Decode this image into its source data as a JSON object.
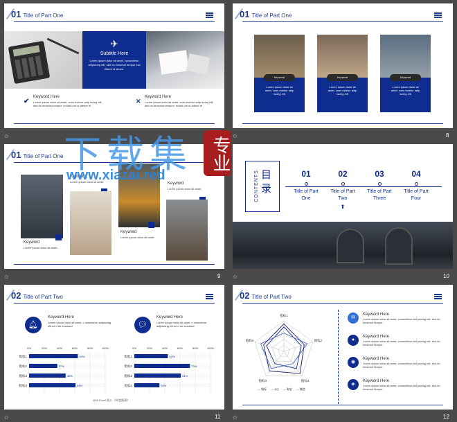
{
  "watermark": {
    "title": "下载集",
    "badge": "专业",
    "url": "www.xiazai.red"
  },
  "slide7": {
    "num": "01",
    "title": "Title of Part One",
    "subtitle": "Subtitle Here",
    "blue_text": "Lorem ipsum dolor sit amet, consectetur adipiscing elit, sed do eiusmod tempor inci didunt ut labore.",
    "items": [
      {
        "title": "Keyword Here",
        "text": "Lorem ipsum dolor sit amet, cons ectetur adip iscing elit, sed do eiusmod tempor i ncidid unt ut labore et"
      },
      {
        "title": "Keyword Here",
        "text": "Lorem ipsum dolor sit amet, cons ectetur adip iscing elit, sed do eiusmod tempor i ncidid unt ut labore et"
      }
    ]
  },
  "slide8": {
    "num": "01",
    "title": "Title of Part One",
    "page": "8",
    "cards": [
      {
        "label": "Keyword",
        "text": "Lorem ipsum dolor sit amet, cons ectetur adip iscing elit"
      },
      {
        "label": "Keyword",
        "text": "Lorem ipsum dolor sit amet, cons ectetur adip iscing elit"
      },
      {
        "label": "Keyword",
        "text": "Lorem ipsum dolor sit amet, cons ectetur adip iscing elit"
      }
    ]
  },
  "slide9": {
    "num": "01",
    "title": "Title of Part One",
    "page": "9",
    "kw": "Keyword",
    "text": "Lorem ipsum dolor sit amet."
  },
  "slide10": {
    "page": "10",
    "label": "CONTENTS",
    "heading": "目录",
    "parts": [
      {
        "n": "01",
        "line1": "Title of Part",
        "line2": "One"
      },
      {
        "n": "02",
        "line1": "Title of Part",
        "line2": "Two"
      },
      {
        "n": "03",
        "line1": "Title of Part",
        "line2": "Three"
      },
      {
        "n": "04",
        "line1": "Title of Part",
        "line2": "Four"
      }
    ]
  },
  "slide11": {
    "num": "02",
    "title": "Title of Part Two",
    "page": "11",
    "blocks": [
      {
        "title": "Keyword Here",
        "text": "Lorem ipsum dolor sit amet, c onsectetur adipiscing elit,se d do eiusmod"
      },
      {
        "title": "Keyword Here",
        "text": "Lorem ipsum dolor sit amet, c onsectetur adipiscing elit,se d do eiusmod"
      }
    ],
    "ticks": [
      "0%",
      "20%",
      "40%",
      "60%",
      "80%",
      "100%"
    ],
    "caption": "@Ql Excel 插入 《学会图表》"
  },
  "slide12": {
    "num": "02",
    "title": "Title of Part Two",
    "page": "12",
    "legend": [
      "指标",
      "QQ",
      "淘宝",
      "微信"
    ],
    "keywords": [
      {
        "title": "Keyword Here",
        "text": "Lorem ipsum dolor sit amet, consectetur adi piscing elit, sed do eiusmod tempor"
      },
      {
        "title": "Keyword Here",
        "text": "Lorem ipsum dolor sit amet, consectetur adi piscing elit, sed do eiusmod tempor"
      },
      {
        "title": "Keyword Here",
        "text": "Lorem ipsum dolor sit amet, consectetur adi piscing elit, sed do eiusmod tempor"
      },
      {
        "title": "Keyword Here",
        "text": "Lorem ipsum dolor sit amet, consectetur adi piscing elit, sed do eiusmod tempor"
      }
    ]
  },
  "chart_data": [
    {
      "type": "bar",
      "categories": [
        "指标1",
        "指标2",
        "指标3",
        "指标4"
      ],
      "values": [
        64,
        37,
        48,
        61
      ],
      "xlim": [
        0,
        100
      ]
    },
    {
      "type": "bar",
      "categories": [
        "指标1",
        "指标2",
        "指标3",
        "指标4"
      ],
      "values": [
        44,
        73,
        61,
        33
      ],
      "xlim": [
        0,
        100
      ]
    },
    {
      "type": "radar",
      "categories": [
        "指标1",
        "指标2",
        "指标3",
        "指标4",
        "指标5"
      ],
      "series": [
        {
          "name": "QQ",
          "values": [
            0.8,
            0.6,
            0.7,
            0.5,
            0.6
          ]
        },
        {
          "name": "淘宝",
          "values": [
            0.6,
            0.8,
            0.5,
            0.7,
            0.8
          ]
        },
        {
          "name": "微信",
          "values": [
            0.9,
            0.7,
            0.9,
            0.8,
            0.7
          ]
        }
      ]
    }
  ]
}
